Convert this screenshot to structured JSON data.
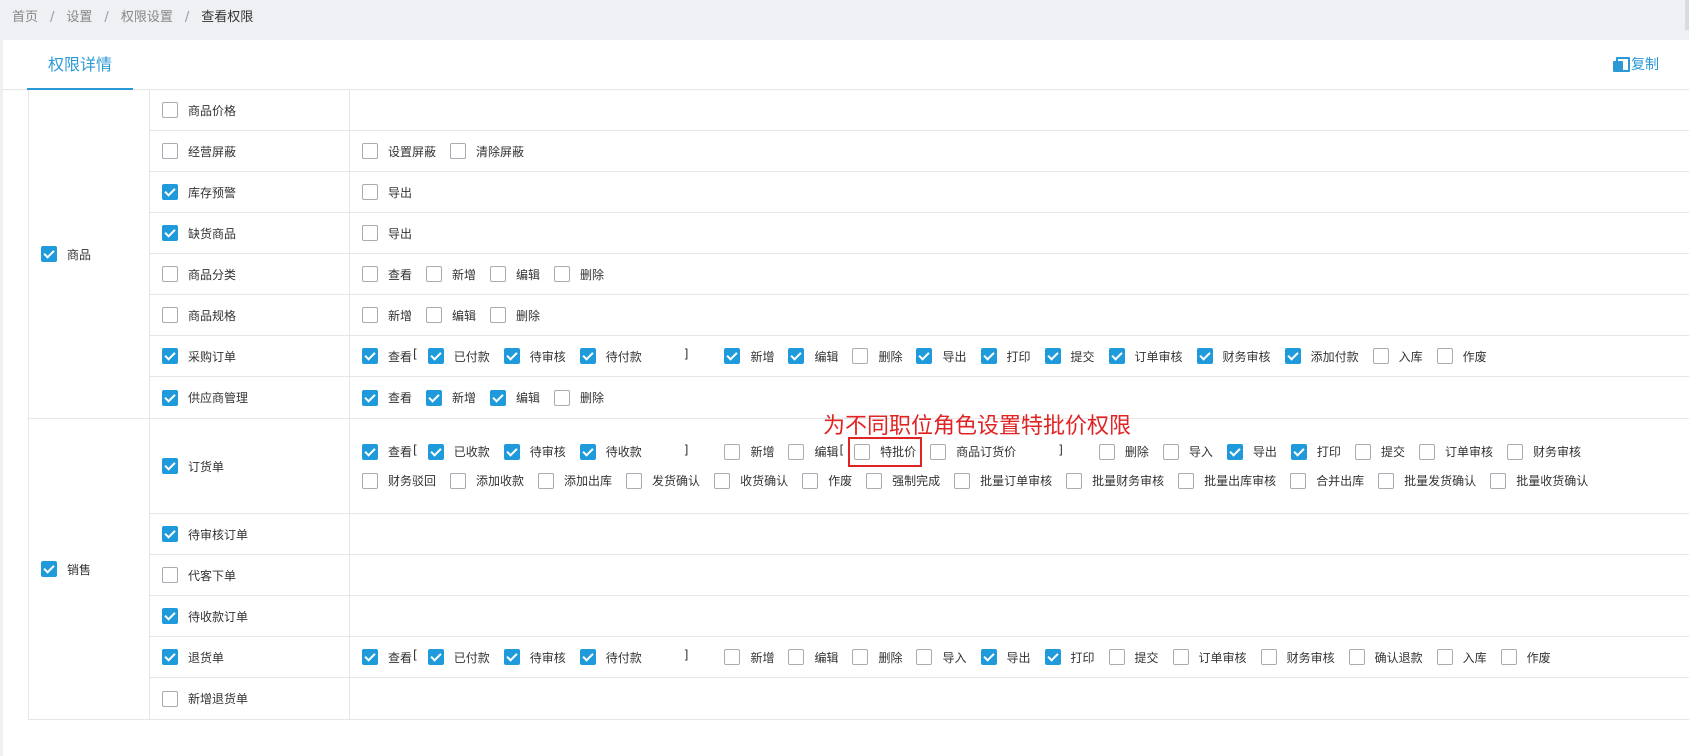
{
  "breadcrumb": [
    "首页",
    "设置",
    "权限设置",
    "查看权限"
  ],
  "tab": "权限详情",
  "copy_label": "复制",
  "annotation": "为不同职位角色设置特批价权限",
  "groups": [
    {
      "label": "商品",
      "checked": true,
      "rows": [
        {
          "label": "商品价格",
          "checked": false,
          "items": []
        },
        {
          "label": "经营屏蔽",
          "checked": false,
          "items": [
            {
              "label": "设置屏蔽",
              "checked": false
            },
            {
              "label": "清除屏蔽",
              "checked": false
            }
          ]
        },
        {
          "label": "库存预警",
          "checked": true,
          "items": [
            {
              "label": "导出",
              "checked": false
            }
          ]
        },
        {
          "label": "缺货商品",
          "checked": true,
          "items": [
            {
              "label": "导出",
              "checked": false
            }
          ]
        },
        {
          "label": "商品分类",
          "checked": false,
          "items": [
            {
              "label": "查看",
              "checked": false
            },
            {
              "label": "新增",
              "checked": false
            },
            {
              "label": "编辑",
              "checked": false
            },
            {
              "label": "删除",
              "checked": false
            }
          ]
        },
        {
          "label": "商品规格",
          "checked": false,
          "items": [
            {
              "label": "新增",
              "checked": false
            },
            {
              "label": "编辑",
              "checked": false
            },
            {
              "label": "删除",
              "checked": false
            }
          ]
        },
        {
          "label": "采购订单",
          "checked": true,
          "items": [
            {
              "label": "查看",
              "checked": true,
              "open": true
            },
            {
              "label": "已付款",
              "checked": true
            },
            {
              "label": "待审核",
              "checked": true
            },
            {
              "label": "待付款",
              "checked": true,
              "close": true
            },
            {
              "label": "新增",
              "checked": true
            },
            {
              "label": "编辑",
              "checked": true
            },
            {
              "label": "删除",
              "checked": false
            },
            {
              "label": "导出",
              "checked": true
            },
            {
              "label": "打印",
              "checked": true
            },
            {
              "label": "提交",
              "checked": true
            },
            {
              "label": "订单审核",
              "checked": true
            },
            {
              "label": "财务审核",
              "checked": true
            },
            {
              "label": "添加付款",
              "checked": true
            },
            {
              "label": "入库",
              "checked": false
            },
            {
              "label": "作废",
              "checked": false
            }
          ]
        },
        {
          "label": "供应商管理",
          "checked": true,
          "items": [
            {
              "label": "查看",
              "checked": true
            },
            {
              "label": "新增",
              "checked": true
            },
            {
              "label": "编辑",
              "checked": true
            },
            {
              "label": "删除",
              "checked": false
            }
          ]
        }
      ]
    },
    {
      "label": "销售",
      "checked": true,
      "rows": [
        {
          "label": "订货单",
          "checked": true,
          "items": [
            {
              "label": "查看",
              "checked": true,
              "open": true
            },
            {
              "label": "已收款",
              "checked": true
            },
            {
              "label": "待审核",
              "checked": true
            },
            {
              "label": "待收款",
              "checked": true,
              "close": true
            },
            {
              "label": "新增",
              "checked": false
            },
            {
              "label": "编辑",
              "checked": false,
              "open": true
            },
            {
              "label": "特批价",
              "checked": false,
              "highlight": true
            },
            {
              "label": "商品订货价",
              "checked": false,
              "close": true
            },
            {
              "label": "删除",
              "checked": false
            },
            {
              "label": "导入",
              "checked": false
            },
            {
              "label": "导出",
              "checked": true
            },
            {
              "label": "打印",
              "checked": true
            },
            {
              "label": "提交",
              "checked": false
            },
            {
              "label": "订单审核",
              "checked": false
            },
            {
              "label": "财务审核",
              "checked": false
            },
            {
              "label": "财务驳回",
              "checked": false
            },
            {
              "label": "添加收款",
              "checked": false
            },
            {
              "label": "添加出库",
              "checked": false
            },
            {
              "label": "发货确认",
              "checked": false
            },
            {
              "label": "收货确认",
              "checked": false
            },
            {
              "label": "作废",
              "checked": false
            },
            {
              "label": "强制完成",
              "checked": false
            },
            {
              "label": "批量订单审核",
              "checked": false
            },
            {
              "label": "批量财务审核",
              "checked": false
            },
            {
              "label": "批量出库审核",
              "checked": false
            },
            {
              "label": "合并出库",
              "checked": false
            },
            {
              "label": "批量发货确认",
              "checked": false
            },
            {
              "label": "批量收货确认",
              "checked": false
            }
          ]
        },
        {
          "label": "待审核订单",
          "checked": true,
          "items": []
        },
        {
          "label": "代客下单",
          "checked": false,
          "items": []
        },
        {
          "label": "待收款订单",
          "checked": true,
          "items": []
        },
        {
          "label": "退货单",
          "checked": true,
          "items": [
            {
              "label": "查看",
              "checked": true,
              "open": true
            },
            {
              "label": "已付款",
              "checked": true
            },
            {
              "label": "待审核",
              "checked": true
            },
            {
              "label": "待付款",
              "checked": true,
              "close": true
            },
            {
              "label": "新增",
              "checked": false
            },
            {
              "label": "编辑",
              "checked": false
            },
            {
              "label": "删除",
              "checked": false
            },
            {
              "label": "导入",
              "checked": false
            },
            {
              "label": "导出",
              "checked": true
            },
            {
              "label": "打印",
              "checked": true
            },
            {
              "label": "提交",
              "checked": false
            },
            {
              "label": "订单审核",
              "checked": false
            },
            {
              "label": "财务审核",
              "checked": false
            },
            {
              "label": "确认退款",
              "checked": false
            },
            {
              "label": "入库",
              "checked": false
            },
            {
              "label": "作废",
              "checked": false
            }
          ]
        },
        {
          "label": "新增退货单",
          "checked": false,
          "items": []
        }
      ]
    }
  ]
}
